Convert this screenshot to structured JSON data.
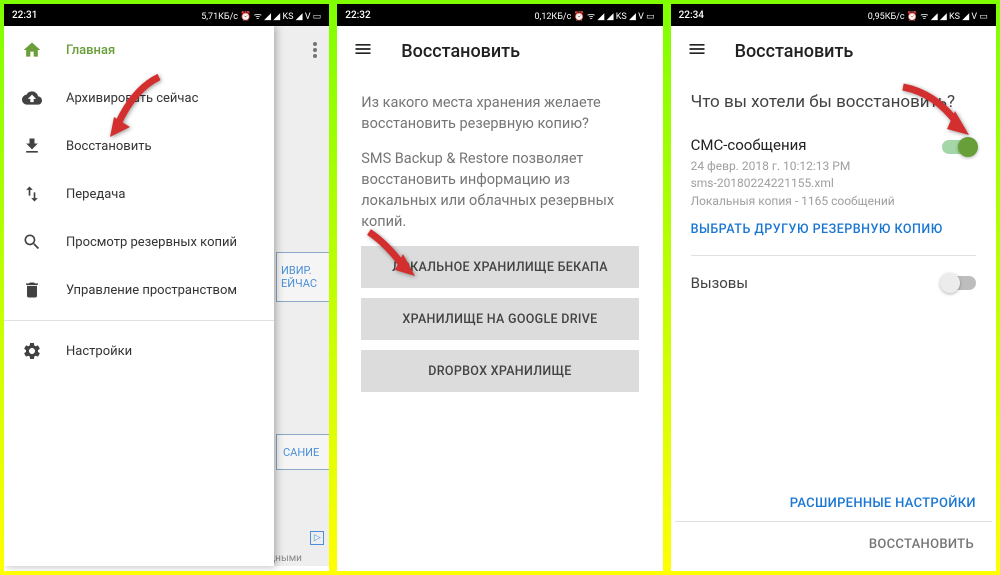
{
  "panel1": {
    "statusbar": {
      "time": "22:31",
      "right": "5,71КБ/с ⏰ ᯤ ◢ ◢ KS ◢ V ▭"
    },
    "drawer": [
      {
        "icon": "home",
        "label": "Главная",
        "active": true
      },
      {
        "icon": "cloud-up",
        "label": "Архивировать сейчас"
      },
      {
        "icon": "download",
        "label": "Восстановить"
      },
      {
        "icon": "transfer",
        "label": "Передача"
      },
      {
        "icon": "search",
        "label": "Просмотр резервных копий"
      },
      {
        "icon": "trash",
        "label": "Управление пространством"
      },
      {
        "icon": "gear",
        "label": "Настройки"
      }
    ],
    "bg_text1a": "ИВИР.",
    "bg_text1b": "ЕЙЧАС",
    "bg_text2": "САНИЕ",
    "ad_text": "связь с дными"
  },
  "panel2": {
    "statusbar": {
      "time": "22:32",
      "right": "0,12КБ/с ⏰ ᯤ ◢ ◢ KS ◢ V ▭"
    },
    "title": "Восстановить",
    "text1": "Из какого места хранения желаете восстановить резервную копию?",
    "text2": "SMS Backup & Restore позволяет восстановить информацию из локальных или облачных резервных копий.",
    "buttons": [
      "ЛОКАЛЬНОЕ ХРАНИЛИЩЕ БЕКАПА",
      "ХРАНИЛИЩЕ НА GOOGLE DRIVE",
      "DROPBOX ХРАНИЛИЩЕ"
    ]
  },
  "panel3": {
    "statusbar": {
      "time": "22:34",
      "right": "0,95КБ/с ⏰ ᯤ ◢ ◢ KS ◢ V ▭"
    },
    "title": "Восстановить",
    "question": "Что вы хотели бы восстановить?",
    "sms_title": "СМС-сообщения",
    "sms_date": "24 февр. 2018 г. 10:12:13 PM",
    "sms_file": "sms-20180224221155.xml",
    "sms_count": "Локальныя копия - 1165 сообщений",
    "choose_other": "ВЫБРАТЬ ДРУГУЮ РЕЗЕРВНУЮ КОПИЮ",
    "calls": "Вызовы",
    "advanced": "РАСШИРЕННЫЕ НАСТРОЙКИ",
    "restore_btn": "ВОССТАНОВИТЬ"
  }
}
